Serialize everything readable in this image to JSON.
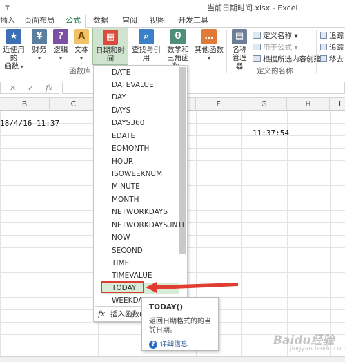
{
  "window": {
    "title": "当前日期时间.xlsx - Excel",
    "qat_mark": "〒"
  },
  "tabs": [
    "插入",
    "页面布局",
    "公式",
    "数据",
    "审阅",
    "视图",
    "开发工具"
  ],
  "active_tab": "公式",
  "ribbon": {
    "recent_label_1": "近使用的",
    "recent_label_2": "函数",
    "finance_label": "财务",
    "logic_label": "逻辑",
    "text_label": "文本",
    "datetime_label": "日期和时间",
    "lookup_label": "查找与引用",
    "math_label_1": "数学和",
    "math_label_2": "三角函数",
    "other_label": "其他函数",
    "name_mgr_label_1": "名称",
    "name_mgr_label_2": "管理器",
    "define_name": "定义名称",
    "use_in_formula": "用于公式",
    "create_from_sel": "根据所选内容创建",
    "trace_1": "追踪",
    "trace_2": "追踪",
    "remove": "移去",
    "group_funclib": "函数库",
    "group_names": "定义的名称"
  },
  "formula_bar": {
    "fx": "fx",
    "cancel": "✕",
    "enter": "✓",
    "value": ""
  },
  "columns": [
    "B",
    "C",
    "D",
    "E",
    "F",
    "G",
    "H",
    "I"
  ],
  "cells": {
    "B_value": "18/4/16 11:37",
    "G_value": "11:37:54"
  },
  "menu": {
    "items": [
      "DATE",
      "DATEVALUE",
      "DAY",
      "DAYS",
      "DAYS360",
      "EDATE",
      "EOMONTH",
      "HOUR",
      "ISOWEEKNUM",
      "MINUTE",
      "MONTH",
      "NETWORKDAYS",
      "NETWORKDAYS.INTL",
      "NOW",
      "SECOND",
      "TIME",
      "TIMEVALUE",
      "TODAY",
      "WEEKDAY"
    ],
    "selected": "TODAY",
    "footer_fx": "fx",
    "footer_label": "插入函数(F)..."
  },
  "tooltip": {
    "title": "TODAY()",
    "description": "返回日期格式的的当前日期。",
    "help": "详细信息",
    "help_icon": "?"
  },
  "watermark": {
    "text": "Baidu经验",
    "sub": "jingyan.baidu.com"
  },
  "colors": {
    "accent": "#217346",
    "highlight": "#e03c31",
    "selected_bg": "#d7ecd7"
  }
}
